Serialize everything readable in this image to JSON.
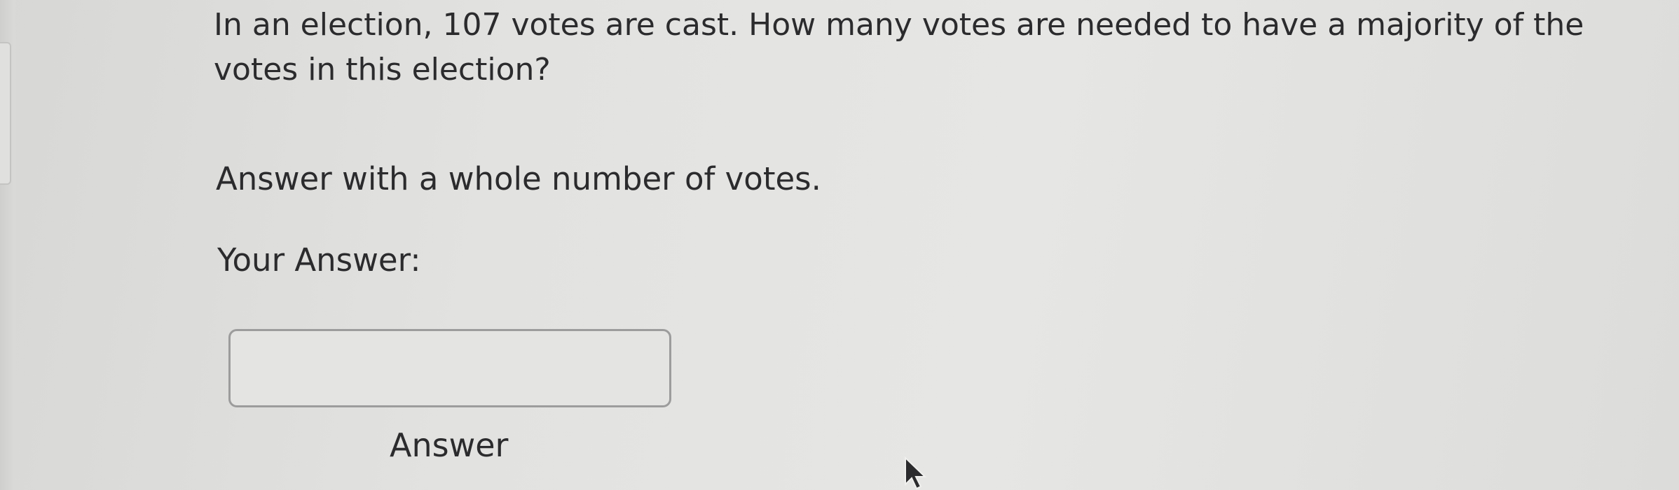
{
  "question": {
    "text": "In an election, 107 votes are cast. How many votes are needed to have a majority of the votes in this election?"
  },
  "instruction": {
    "text": "Answer with a whole number of votes."
  },
  "answer_section": {
    "label": "Your Answer:",
    "input_value": "",
    "input_placeholder": "",
    "submit_label": "Answer"
  },
  "icons": {
    "cursor": "mouse-pointer-icon"
  },
  "colors": {
    "text": "#2b2b2d",
    "background": "#e2e2e0",
    "input_border": "#9c9c9c"
  }
}
